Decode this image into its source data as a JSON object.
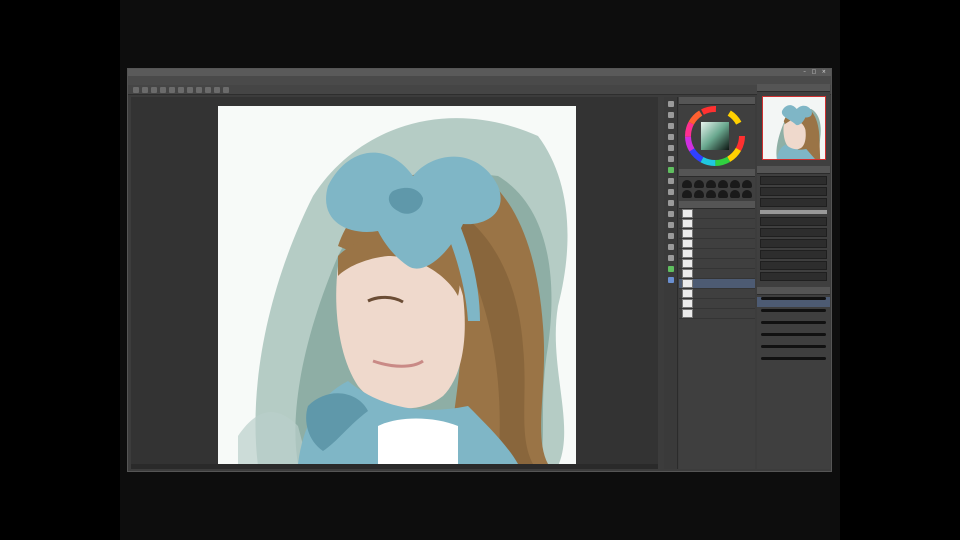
{
  "app": {
    "title": "",
    "window_controls": "– □ ×"
  },
  "menu": [
    "",
    "",
    "",
    "",
    "",
    "",
    "",
    ""
  ],
  "layers": [
    {
      "name": ""
    },
    {
      "name": ""
    },
    {
      "name": ""
    },
    {
      "name": ""
    },
    {
      "name": ""
    },
    {
      "name": ""
    },
    {
      "name": ""
    },
    {
      "name": ""
    },
    {
      "name": ""
    },
    {
      "name": ""
    },
    {
      "name": ""
    }
  ],
  "colors": {
    "background": "#3c3c3c",
    "canvas": "#f7faf8",
    "bow": "#7fb6c6",
    "hair": "#9a7446",
    "wash": "#6e958a"
  },
  "icons": [
    "pen-icon",
    "eraser-icon",
    "fill-icon",
    "select-icon",
    "eye-icon",
    "color-wheel-icon",
    "brush-size-icon"
  ]
}
